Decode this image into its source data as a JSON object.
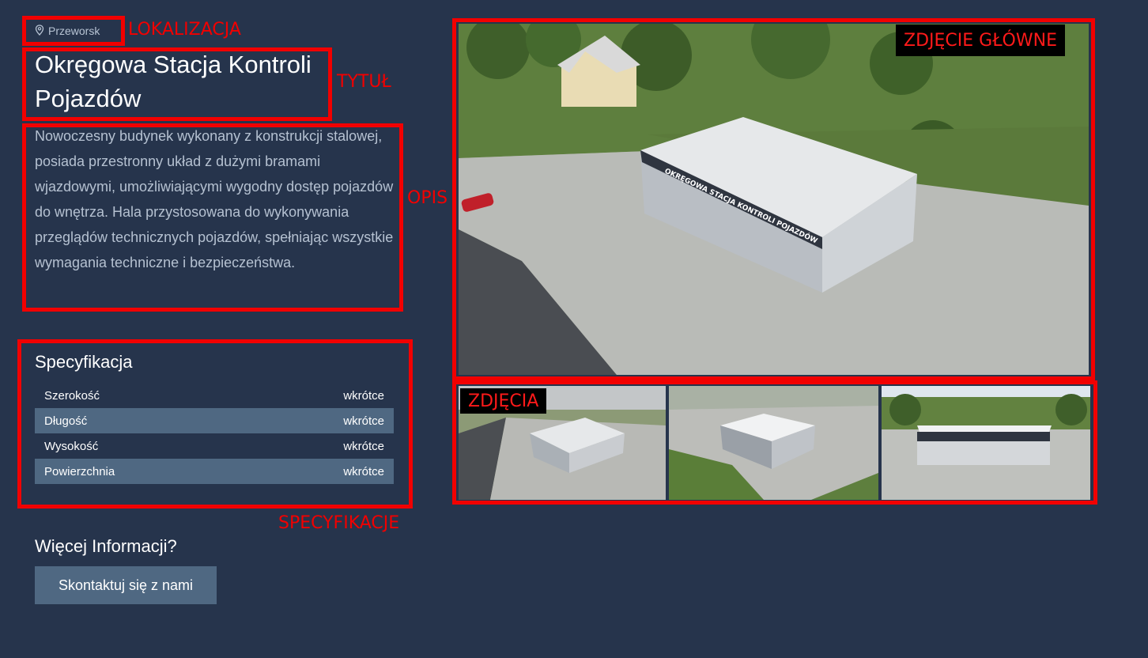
{
  "location": {
    "icon": "map-pin-icon",
    "text": "Przeworsk"
  },
  "title": "Okręgowa Stacja Kontroli Pojazdów",
  "description": "Nowoczesny budynek wykonany z konstrukcji stalowej, posiada przestronny układ z dużymi bramami wjazdowymi, umożliwiającymi wygodny dostęp pojazdów do wnętrza. Hala przystosowana do wykonywania przeglądów technicznych pojazdów, spełniając wszystkie wymagania techniczne i bezpieczeństwa.",
  "specs": {
    "title": "Specyfikacja",
    "rows": [
      {
        "label": "Szerokość",
        "value": "wkrótce"
      },
      {
        "label": "Długość",
        "value": "wkrótce"
      },
      {
        "label": "Wysokość",
        "value": "wkrótce"
      },
      {
        "label": "Powierzchnia",
        "value": "wkrótce"
      }
    ]
  },
  "more": {
    "title": "Więcej Informacji?",
    "button": "Skontaktuj się z nami"
  },
  "photos": {
    "building_sign": "OKRĘGOWA STACJA KONTROLI POJAZDÓW"
  },
  "annotations": {
    "location": "LOKALIZACJA",
    "title": "TYTUŁ",
    "description": "OPIS",
    "specs": "SPECYFIKACJE",
    "main_photo": "ZDJĘCIE GŁÓWNE",
    "photos": "ZDJĘCIA"
  },
  "colors": {
    "background": "#26344c",
    "accent": "#4f6882",
    "annotation": "#f20000"
  }
}
